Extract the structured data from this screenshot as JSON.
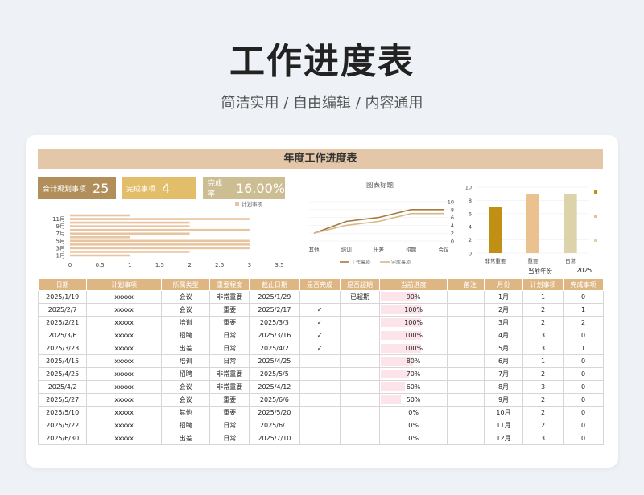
{
  "hero": {
    "title": "工作进度表",
    "subtitle": "简洁实用 / 自由编辑 / 内容通用"
  },
  "sheet": {
    "banner": "年度工作进度表",
    "kpis": [
      {
        "label": "合计规划事项",
        "value": "25"
      },
      {
        "label": "完成事项",
        "value": "4"
      },
      {
        "label": "完成率",
        "value": "16.00%"
      }
    ],
    "year_label": "当前年份",
    "year_value": "2025"
  },
  "chart_data": [
    {
      "type": "bar",
      "orientation": "horizontal",
      "categories": [
        "1月",
        "2月",
        "3月",
        "4月",
        "5月",
        "6月",
        "7月",
        "8月",
        "9月",
        "10月",
        "11月",
        "12月"
      ],
      "visible_tick_labels": [
        "1月",
        "3月",
        "5月",
        "7月",
        "9月",
        "11月"
      ],
      "series": [
        {
          "name": "计划事项",
          "values": [
            1,
            2,
            3,
            3,
            3,
            1,
            2,
            3,
            2,
            2,
            3,
            1
          ]
        }
      ],
      "xlim": [
        0,
        3.5
      ],
      "xticks": [
        "0",
        "0.5",
        "1",
        "1.5",
        "2",
        "2.5",
        "3",
        "3.5"
      ],
      "legend": "top",
      "color": "#e8c4a0"
    },
    {
      "type": "line",
      "title": "图表标题",
      "categories": [
        "其他",
        "培训",
        "出差",
        "招聘",
        "会议"
      ],
      "series": [
        {
          "name": "工作事项",
          "values": [
            2,
            5,
            6,
            8,
            8
          ],
          "color": "#a57a3a"
        },
        {
          "name": "完成事项",
          "values": [
            2,
            4,
            5,
            7,
            7
          ],
          "color": "#d6b98a"
        }
      ],
      "ylim": [
        0,
        10
      ],
      "yticks": [
        "0",
        "2",
        "4",
        "6",
        "8",
        "10"
      ],
      "legend": "bottom"
    },
    {
      "type": "bar",
      "categories": [
        "非常重要",
        "重要",
        "日常"
      ],
      "values": [
        7,
        9,
        9
      ],
      "colors": [
        "#c08f14",
        "#ecc190",
        "#dcd3ab"
      ],
      "ylim": [
        0,
        10
      ],
      "yticks": [
        "0",
        "2",
        "4",
        "6",
        "8",
        "10"
      ],
      "legend": "right"
    }
  ],
  "tasks": {
    "headers": [
      "日期",
      "计划事项",
      "所属类型",
      "重要程度",
      "截止日期",
      "是否完成",
      "是否超期",
      "当前进度",
      "备注"
    ],
    "rows": [
      [
        "2025/1/19",
        "xxxxx",
        "会议",
        "非常重要",
        "2025/1/29",
        "",
        "已超期",
        "90%",
        ""
      ],
      [
        "2025/2/7",
        "xxxxx",
        "会议",
        "重要",
        "2025/2/17",
        "✓",
        "",
        "100%",
        ""
      ],
      [
        "2025/2/21",
        "xxxxx",
        "培训",
        "重要",
        "2025/3/3",
        "✓",
        "",
        "100%",
        ""
      ],
      [
        "2025/3/6",
        "xxxxx",
        "招聘",
        "日常",
        "2025/3/16",
        "✓",
        "",
        "100%",
        ""
      ],
      [
        "2025/3/23",
        "xxxxx",
        "出差",
        "日常",
        "2025/4/2",
        "✓",
        "",
        "100%",
        ""
      ],
      [
        "2025/4/15",
        "xxxxx",
        "培训",
        "日常",
        "2025/4/25",
        "",
        "",
        "80%",
        ""
      ],
      [
        "2025/4/25",
        "xxxxx",
        "招聘",
        "非常重要",
        "2025/5/5",
        "",
        "",
        "70%",
        ""
      ],
      [
        "2025/4/2",
        "xxxxx",
        "会议",
        "非常重要",
        "2025/4/12",
        "",
        "",
        "60%",
        ""
      ],
      [
        "2025/5/27",
        "xxxxx",
        "会议",
        "重要",
        "2025/6/6",
        "",
        "",
        "50%",
        ""
      ],
      [
        "2025/5/10",
        "xxxxx",
        "其他",
        "重要",
        "2025/5/20",
        "",
        "",
        "0%",
        ""
      ],
      [
        "2025/5/22",
        "xxxxx",
        "招聘",
        "日常",
        "2025/6/1",
        "",
        "",
        "0%",
        ""
      ],
      [
        "2025/6/30",
        "xxxxx",
        "出差",
        "日常",
        "2025/7/10",
        "",
        "",
        "0%",
        ""
      ]
    ],
    "progress": [
      0.9,
      1,
      1,
      1,
      1,
      0.8,
      0.7,
      0.6,
      0.5,
      0,
      0,
      0
    ]
  },
  "months": {
    "headers": [
      "月份",
      "计划事项",
      "完成事项"
    ],
    "rows": [
      [
        "1月",
        "1",
        "0"
      ],
      [
        "2月",
        "2",
        "1"
      ],
      [
        "3月",
        "2",
        "2"
      ],
      [
        "4月",
        "3",
        "0"
      ],
      [
        "5月",
        "3",
        "1"
      ],
      [
        "6月",
        "1",
        "0"
      ],
      [
        "7月",
        "2",
        "0"
      ],
      [
        "8月",
        "3",
        "0"
      ],
      [
        "9月",
        "2",
        "0"
      ],
      [
        "10月",
        "2",
        "0"
      ],
      [
        "11月",
        "2",
        "0"
      ],
      [
        "12月",
        "3",
        "0"
      ]
    ]
  }
}
